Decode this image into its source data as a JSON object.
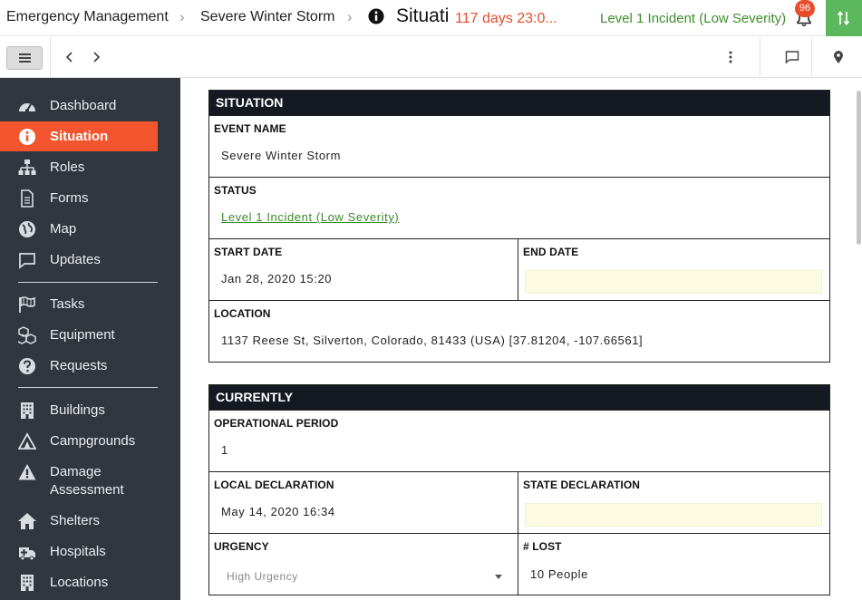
{
  "header": {
    "breadcrumbs": [
      "Emergency Management",
      "Severe Winter Storm"
    ],
    "page_name": "Situation",
    "timer": "117 days 23:0...",
    "severity": "Level 1 Incident (Low Severity)",
    "notification_count": "96"
  },
  "sidebar": {
    "items": [
      {
        "label": "Dashboard",
        "icon": "dashboard-icon"
      },
      {
        "label": "Situation",
        "icon": "info-icon",
        "active": true
      },
      {
        "label": "Roles",
        "icon": "org-chart-icon"
      },
      {
        "label": "Forms",
        "icon": "document-icon"
      },
      {
        "label": "Map",
        "icon": "globe-icon"
      },
      {
        "label": "Updates",
        "icon": "chat-icon"
      },
      {
        "label": "Tasks",
        "icon": "flag-icon"
      },
      {
        "label": "Equipment",
        "icon": "boxes-icon"
      },
      {
        "label": "Requests",
        "icon": "question-icon"
      },
      {
        "label": "Buildings",
        "icon": "building-icon"
      },
      {
        "label": "Campgrounds",
        "icon": "tent-icon"
      },
      {
        "label": "Damage\nAssessment",
        "icon": "warning-icon"
      },
      {
        "label": "Shelters",
        "icon": "house-icon"
      },
      {
        "label": "Hospitals",
        "icon": "ambulance-icon"
      },
      {
        "label": "Locations",
        "icon": "building-icon"
      }
    ]
  },
  "situation": {
    "title": "SITUATION",
    "event_name_label": "EVENT NAME",
    "event_name": "Severe Winter Storm",
    "status_label": "STATUS",
    "status": "Level 1 Incident (Low Severity)",
    "start_date_label": "START DATE",
    "start_date": "Jan 28, 2020 15:20",
    "end_date_label": "END DATE",
    "end_date": "",
    "location_label": "LOCATION",
    "location": "1137 Reese St, Silverton, Colorado, 81433 (USA) [37.81204, -107.66561]"
  },
  "currently": {
    "title": "CURRENTLY",
    "operational_period_label": "OPERATIONAL PERIOD",
    "operational_period": "1",
    "local_declaration_label": "LOCAL DECLARATION",
    "local_declaration": "May 14, 2020 16:34",
    "state_declaration_label": "STATE DECLARATION",
    "state_declaration": "",
    "urgency_label": "URGENCY",
    "urgency": "High Urgency",
    "lost_label": "# LOST",
    "lost": "10 People"
  },
  "colors": {
    "accent": "#f3562e",
    "sidebar_bg": "#31363f",
    "severity_green": "#3b8f2a",
    "timer_red": "#ea4b2b",
    "section_header": "#151a22",
    "empty_field": "#fcfbe1"
  }
}
